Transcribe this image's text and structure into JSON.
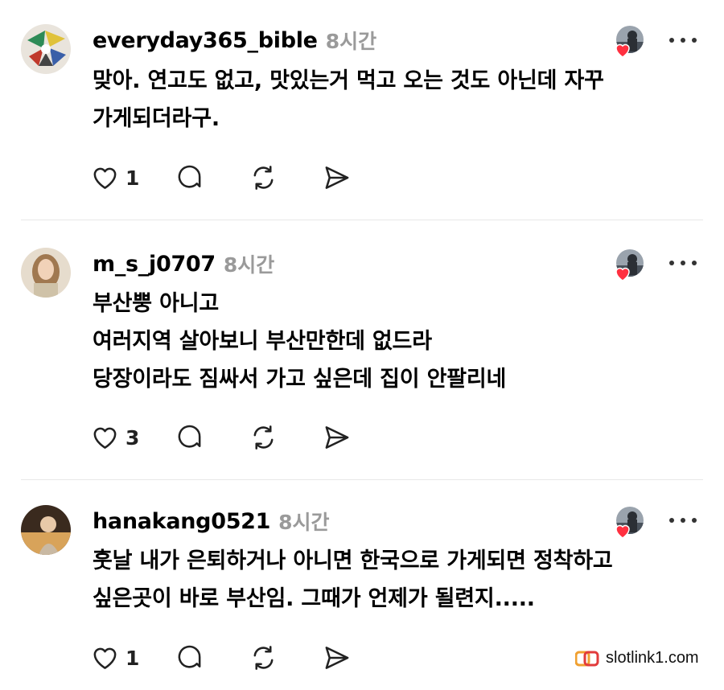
{
  "comments": [
    {
      "username": "everyday365_bible",
      "time": "8시간",
      "text": "맞아. 연고도 없고, 맛있는거 먹고 오는 것도 아닌데 자꾸\n가게되더라구.",
      "like_count": "1"
    },
    {
      "username": "m_s_j0707",
      "time": "8시간",
      "text": "부산뿡 아니고\n여러지역 살아보니 부산만한데 없드라\n당장이라도 짐싸서 가고 싶은데 집이 안팔리네",
      "like_count": "3"
    },
    {
      "username": "hanakang0521",
      "time": "8시간",
      "text": "훗날 내가 은퇴하거나 아니면 한국으로 가게되면 정착하고\n싶은곳이 바로 부산임. 그때가 언제가 될련지.....",
      "like_count": "1"
    }
  ],
  "icons": {
    "like": "heart-outline-icon",
    "reply": "speech-bubble-icon",
    "repost": "repost-arrows-icon",
    "share": "send-paper-plane-icon",
    "more": "more-dots-icon",
    "liked_by_author": "red-heart-icon"
  },
  "watermark": {
    "text": "slotlink1.com"
  },
  "colors": {
    "heart_red": "#ff3040",
    "muted_text": "#9a9a9a",
    "divider": "#e8e8e8"
  }
}
